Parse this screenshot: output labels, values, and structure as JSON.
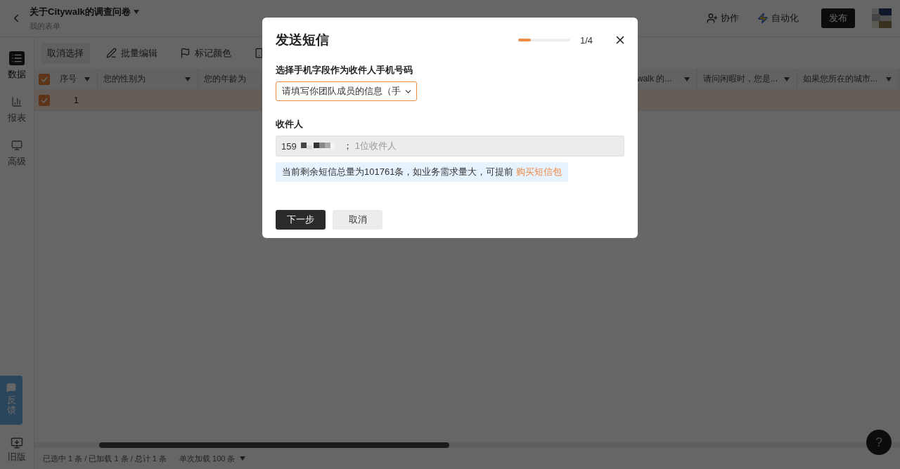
{
  "header": {
    "title": "关于Citywalk的调查问卷",
    "subtitle": "我的表单",
    "actions": [
      {
        "label": "协作",
        "kind": "collab"
      },
      {
        "label": "自动化",
        "kind": "automation"
      }
    ],
    "publish": "发布"
  },
  "sidebar": {
    "items": [
      {
        "label": "数据",
        "kind": "data",
        "selected": true
      },
      {
        "label": "报表",
        "kind": "report",
        "selected": false
      },
      {
        "label": "高级",
        "kind": "advanced",
        "selected": false
      }
    ],
    "feedback": "反馈",
    "legacy": "旧版"
  },
  "toolbar": [
    {
      "kind": "plain",
      "label": "取消选择"
    },
    {
      "kind": "edit",
      "label": "批量编辑"
    },
    {
      "kind": "flag",
      "label": "标记颜色"
    },
    {
      "kind": "phone"
    }
  ],
  "table": {
    "all_checked": true,
    "columns": [
      {
        "label": "序号"
      },
      {
        "label": "您的性别为"
      },
      {
        "label": "您的年龄为"
      },
      {
        "label": "walk 的..."
      },
      {
        "label": "请问闲暇时，您是..."
      },
      {
        "label": "如果您所在的城市..."
      }
    ],
    "rows": [
      {
        "number": "1",
        "checked": true
      }
    ]
  },
  "footer": {
    "summary": "已选中 1 条 / 已加载 1 条 / 总计 1 条",
    "page_size": "单次加载 100 条"
  },
  "help": "?",
  "dialog": {
    "title": "发送短信",
    "progress": {
      "level": 0.25,
      "reading": "1/4"
    },
    "field_label": "选择手机字段作为收件人手机号码",
    "field_value": "请填写你团队成员的信息（手",
    "recipients_label": "收件人",
    "recipient": "159",
    "separator": "；",
    "recipient_count": "1位收件人",
    "notice": "当前剩余短信总量为101761条，如业务需求量大，可提前",
    "notice_link": "购买短信包",
    "buttons": [
      {
        "label": "下一步",
        "kind": "primary"
      },
      {
        "label": "取消",
        "kind": "secondary"
      }
    ]
  }
}
